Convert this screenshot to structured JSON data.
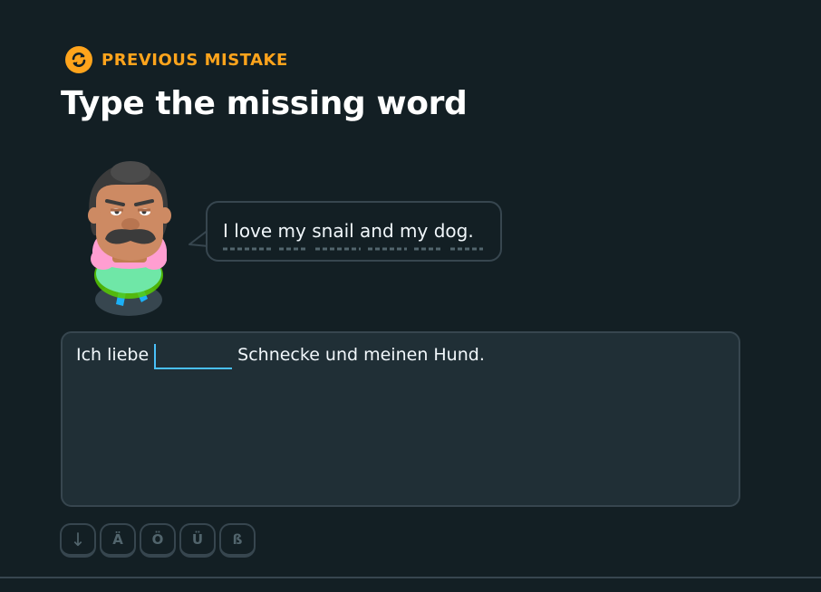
{
  "header": {
    "icon": "refresh-icon",
    "label": "PREVIOUS MISTAKE",
    "accent_color": "#ffa41c"
  },
  "title": "Type the missing word",
  "prompt": {
    "speech": "I love my snail and my dog."
  },
  "exercise": {
    "before_blank": "Ich liebe",
    "blank_value": "",
    "after_blank": "Schnecke und meinen Hund."
  },
  "keyboard": {
    "keys": [
      {
        "label": "↓",
        "icon": "arrow-down-icon"
      },
      {
        "label": "Ä"
      },
      {
        "label": "Ö"
      },
      {
        "label": "Ü"
      },
      {
        "label": "ß"
      }
    ]
  }
}
